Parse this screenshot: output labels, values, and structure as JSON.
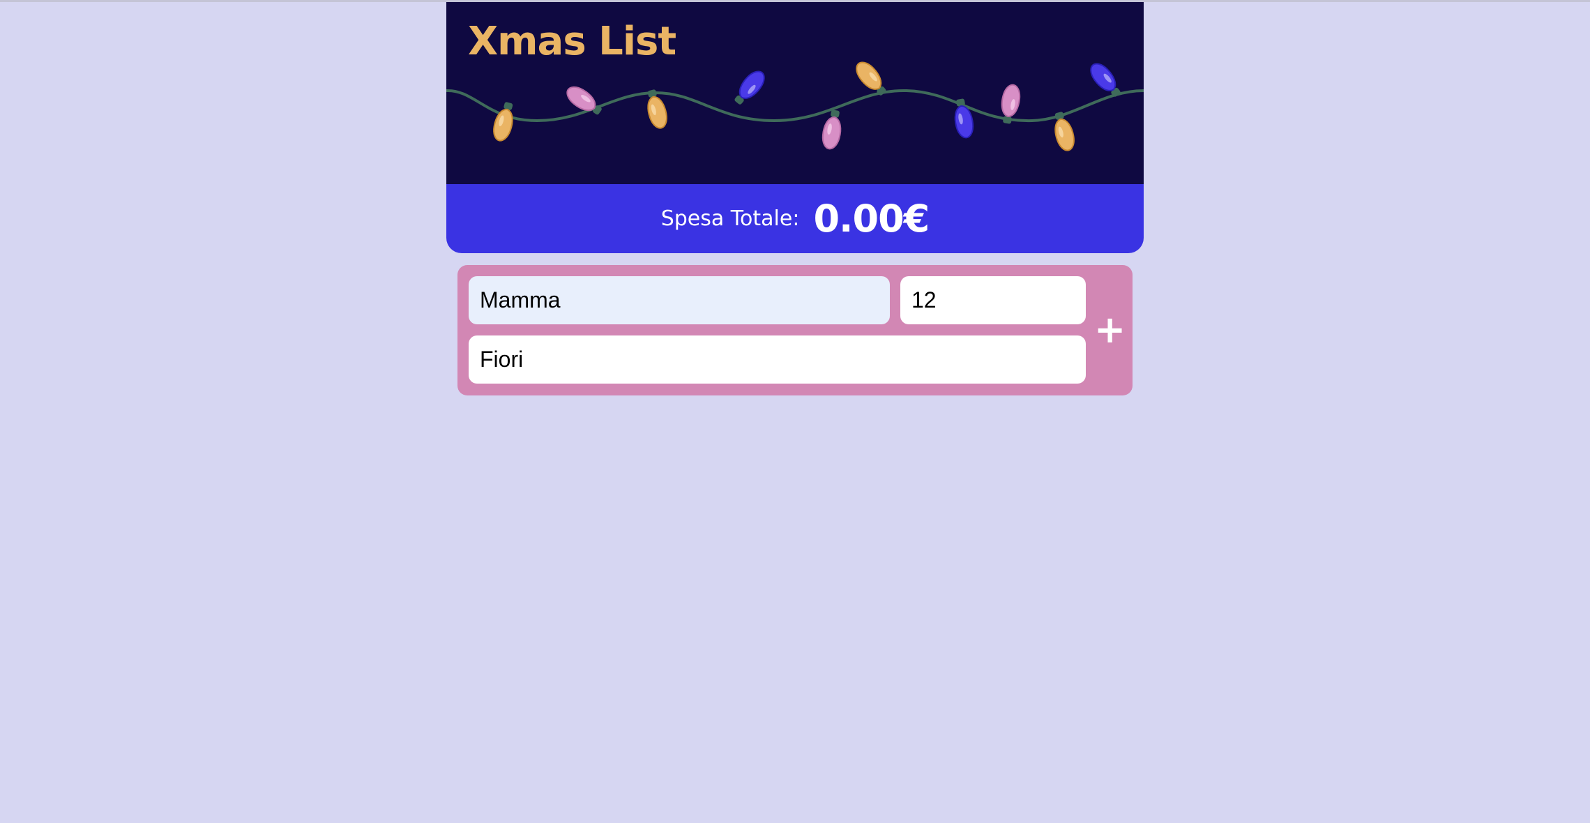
{
  "header": {
    "title": "Xmas List"
  },
  "total": {
    "label": "Spesa Totale:",
    "value": "0.00€"
  },
  "form": {
    "recipient_value": "Mamma",
    "price_value": "12",
    "gift_value": "Fiori",
    "add_label": "+"
  },
  "colors": {
    "page_background": "#d6d6f2",
    "header_background": "#0f0941",
    "title": "#eab464",
    "total_bar": "#3a33e3",
    "form_background": "#d287b4",
    "bulb_yellow": "#eab464",
    "bulb_pink": "#d88fc6",
    "bulb_blue": "#4a3ae8",
    "wire": "#3f6b5a"
  }
}
